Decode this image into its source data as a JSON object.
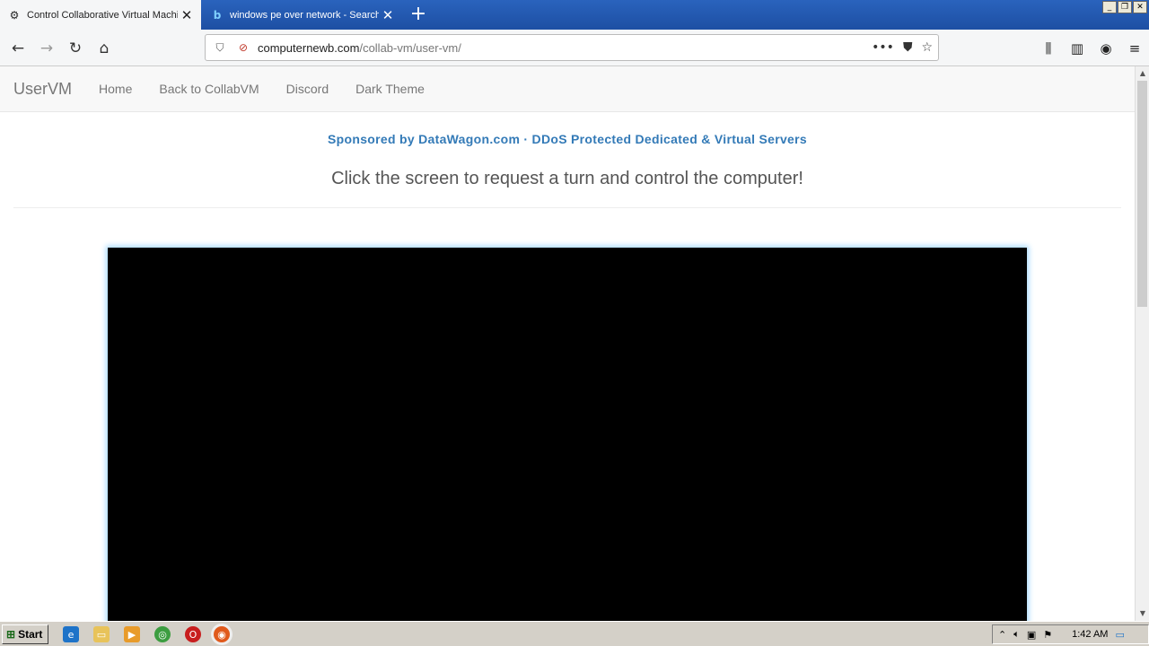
{
  "browser": {
    "tabs": [
      {
        "title": "Control Collaborative Virtual Machi",
        "active": true,
        "favicon": "collabvm-icon"
      },
      {
        "title": "windows pe over network - Search",
        "active": false,
        "favicon": "bing-icon"
      }
    ],
    "url_host": "computernewb.com",
    "url_path": "/collab-vm/user-vm/"
  },
  "site": {
    "brand": "UserVM",
    "nav": [
      "Home",
      "Back to CollabVM",
      "Discord",
      "Dark Theme"
    ],
    "sponsor": "Sponsored by DataWagon.com · DDoS Protected Dedicated & Virtual Servers",
    "lead": "Click the screen to request a turn and control the computer!"
  },
  "watermark": "ANY RUN",
  "taskbar": {
    "start_label": "Start",
    "clock": "1:42 AM"
  },
  "colors": {
    "titlebar": "#1d4fa3",
    "link": "#337ab7",
    "vm_glow": "#a6d9ff"
  }
}
